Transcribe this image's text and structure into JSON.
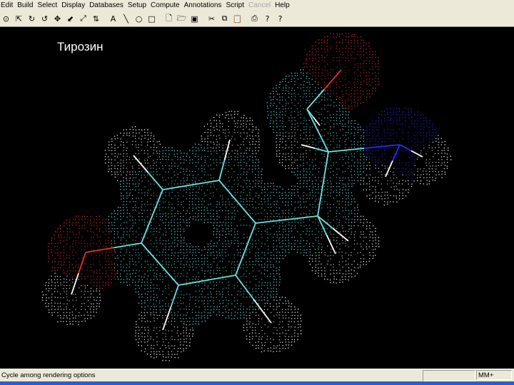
{
  "menu": [
    {
      "label": "Edit",
      "enabled": true
    },
    {
      "label": "Build",
      "enabled": true
    },
    {
      "label": "Select",
      "enabled": true
    },
    {
      "label": "Display",
      "enabled": true
    },
    {
      "label": "Databases",
      "enabled": true
    },
    {
      "label": "Setup",
      "enabled": true
    },
    {
      "label": "Compute",
      "enabled": true
    },
    {
      "label": "Annotations",
      "enabled": true
    },
    {
      "label": "Script",
      "enabled": true
    },
    {
      "label": "Cancel",
      "enabled": false
    },
    {
      "label": "Help",
      "enabled": true
    }
  ],
  "toolbar": [
    {
      "icon": "draw-icon",
      "glyph": "⊙"
    },
    {
      "icon": "select-icon",
      "glyph": "⇱"
    },
    {
      "icon": "rotate-xy-icon",
      "glyph": "↻"
    },
    {
      "icon": "rotate-z-icon",
      "glyph": "↺"
    },
    {
      "icon": "translate-xy-icon",
      "glyph": "✥"
    },
    {
      "icon": "translate-z-icon",
      "glyph": "⬋"
    },
    {
      "icon": "magnify-icon",
      "glyph": "⤢"
    },
    {
      "icon": "z-clip-icon",
      "glyph": "⇅"
    },
    {
      "icon": "text-tool-icon",
      "glyph": "A"
    },
    {
      "icon": "line-tool-icon",
      "glyph": "╲"
    },
    {
      "icon": "ellipse-tool-icon",
      "glyph": "○"
    },
    {
      "icon": "rectangle-tool-icon",
      "glyph": "□"
    },
    {
      "icon": "new-file-icon",
      "glyph": "🗋"
    },
    {
      "icon": "open-file-icon",
      "glyph": "🗁"
    },
    {
      "icon": "save-file-icon",
      "glyph": "▣"
    },
    {
      "icon": "cut-icon",
      "glyph": "✂"
    },
    {
      "icon": "copy-icon",
      "glyph": "⧉"
    },
    {
      "icon": "paste-icon",
      "glyph": "📋"
    },
    {
      "icon": "print-icon",
      "glyph": "⎙"
    },
    {
      "icon": "about-icon",
      "glyph": "?"
    },
    {
      "icon": "context-help-icon",
      "glyph": "?"
    }
  ],
  "molecule": {
    "label": "Тирозин",
    "colors": {
      "carbon": "#6fe0e0",
      "hydrogen": "#ffffff",
      "oxygen": "#e03030",
      "nitrogen": "#2a2aff"
    }
  },
  "status": {
    "message": "Cycle among rendering options",
    "mode": "MM+"
  }
}
